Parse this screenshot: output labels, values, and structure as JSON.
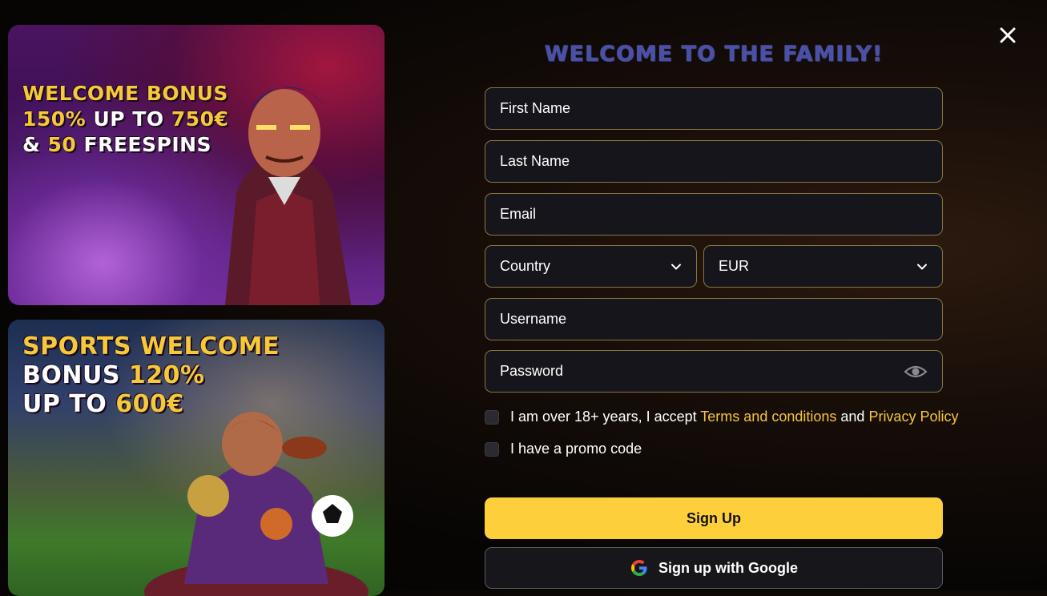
{
  "banners": {
    "casino": {
      "line1": "WELCOME BONUS",
      "line2_gold": "150%",
      "line2_white": " UP TO ",
      "line2_amount": "750€",
      "line3_white": "& ",
      "line3_gold": "50",
      "line3_rest": " FREESPINS"
    },
    "sports": {
      "line1": "SPORTS WELCOME",
      "line2_white": "BONUS ",
      "line2_gold": "120%",
      "line3_white": "UP TO ",
      "line3_gold": "600€"
    }
  },
  "form": {
    "title": "WELCOME TO THE FAMILY!",
    "first_name": "First Name",
    "last_name": "Last Name",
    "email": "Email",
    "country": "Country",
    "currency": "EUR",
    "username": "Username",
    "password": "Password",
    "terms_prefix": "I am over 18+ years, I accept ",
    "terms_link": "Terms and conditions",
    "terms_and": " and ",
    "privacy_link": "Privacy Policy",
    "promo_label": "I have a promo code",
    "signup_label": "Sign Up",
    "google_label": "Sign up with Google"
  },
  "colors": {
    "accent": "#fdd03b",
    "title": "#4a50a8",
    "link": "#f5c53c",
    "field_border": "#8a7545"
  },
  "icons": [
    "close-icon",
    "chevron-down-icon",
    "eye-icon",
    "google-icon"
  ]
}
